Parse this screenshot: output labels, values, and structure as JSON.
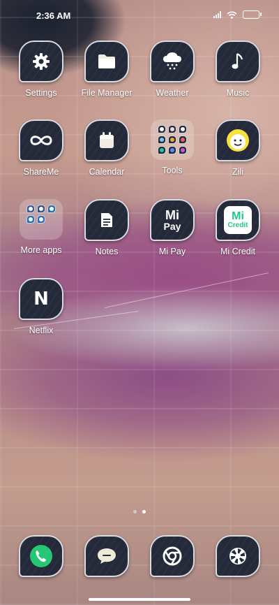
{
  "status_bar": {
    "time": "2:36 AM",
    "icons": [
      "signal-icon",
      "wifi-icon",
      "battery-icon"
    ]
  },
  "home": {
    "apps": [
      {
        "label": "Settings",
        "icon": "gear-icon"
      },
      {
        "label": "File Manager",
        "icon": "folder-icon"
      },
      {
        "label": "Weather",
        "icon": "cloud-snow-icon"
      },
      {
        "label": "Music",
        "icon": "music-note-icon"
      },
      {
        "label": "ShareMe",
        "icon": "infinity-icon"
      },
      {
        "label": "Calendar",
        "icon": "calendar-icon"
      },
      {
        "label": "Tools",
        "icon": "folder-grid-icon"
      },
      {
        "label": "Zili",
        "icon": "zili-face-icon"
      },
      {
        "label": "More apps",
        "icon": "folder-grid-icon"
      },
      {
        "label": "Notes",
        "icon": "note-icon"
      },
      {
        "label": "Mi Pay",
        "icon": "mi-pay-icon"
      },
      {
        "label": "Mi Credit",
        "icon": "mi-credit-icon"
      },
      {
        "label": "Netflix",
        "icon": "netflix-icon"
      }
    ],
    "mi_pay_text": "Pay",
    "mi_text": "Mi",
    "credit_text": "Credit",
    "netflix_letter": "N"
  },
  "pager": {
    "pages": 2,
    "active": 2
  },
  "dock": {
    "apps": [
      {
        "label": "Phone",
        "icon": "phone-icon"
      },
      {
        "label": "Messages",
        "icon": "message-icon"
      },
      {
        "label": "Chrome",
        "icon": "chrome-icon"
      },
      {
        "label": "Camera",
        "icon": "camera-aperture-icon"
      }
    ]
  },
  "colors": {
    "icon_bg": "#252a3a",
    "phone_green": "#23c774",
    "mi_credit_green": "#1fc78a"
  }
}
